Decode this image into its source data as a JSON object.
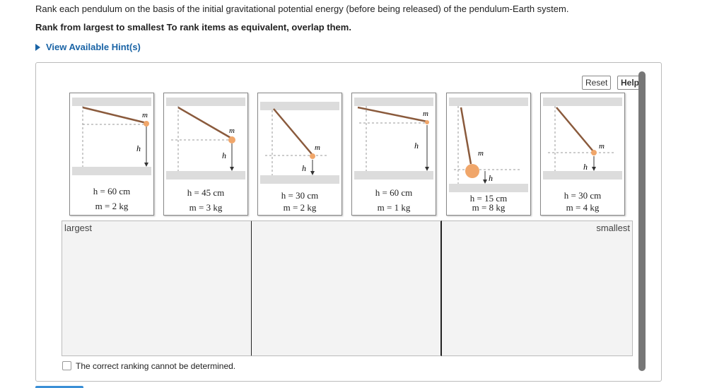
{
  "question": "Rank each pendulum on the basis of the initial gravitational potential energy (before being released) of the pendulum-Earth system.",
  "instruction": "Rank from largest to smallest To rank items as equivalent, overlap them.",
  "hint_link": "View Available Hint(s)",
  "buttons": {
    "reset": "Reset",
    "help": "Help"
  },
  "symbols": {
    "mass": "m",
    "height": "h"
  },
  "cards": [
    {
      "h": "h = 60 cm",
      "m": "m = 2 kg"
    },
    {
      "h": "h = 45 cm",
      "m": "m = 3 kg"
    },
    {
      "h": "h = 30 cm",
      "m": "m = 2 kg"
    },
    {
      "h": "h = 60 cm",
      "m": "m = 1 kg"
    },
    {
      "h": "h = 15 cm",
      "m": "m = 8 kg"
    },
    {
      "h": "h = 30 cm",
      "m": "m = 4 kg"
    }
  ],
  "rank_labels": {
    "largest": "largest",
    "smallest": "smallest"
  },
  "cannot_determine": "The correct ranking cannot be determined.",
  "colors": {
    "accent": "#1a64a6",
    "bob": "#f0a66a",
    "rod": "#8a5a3c"
  }
}
